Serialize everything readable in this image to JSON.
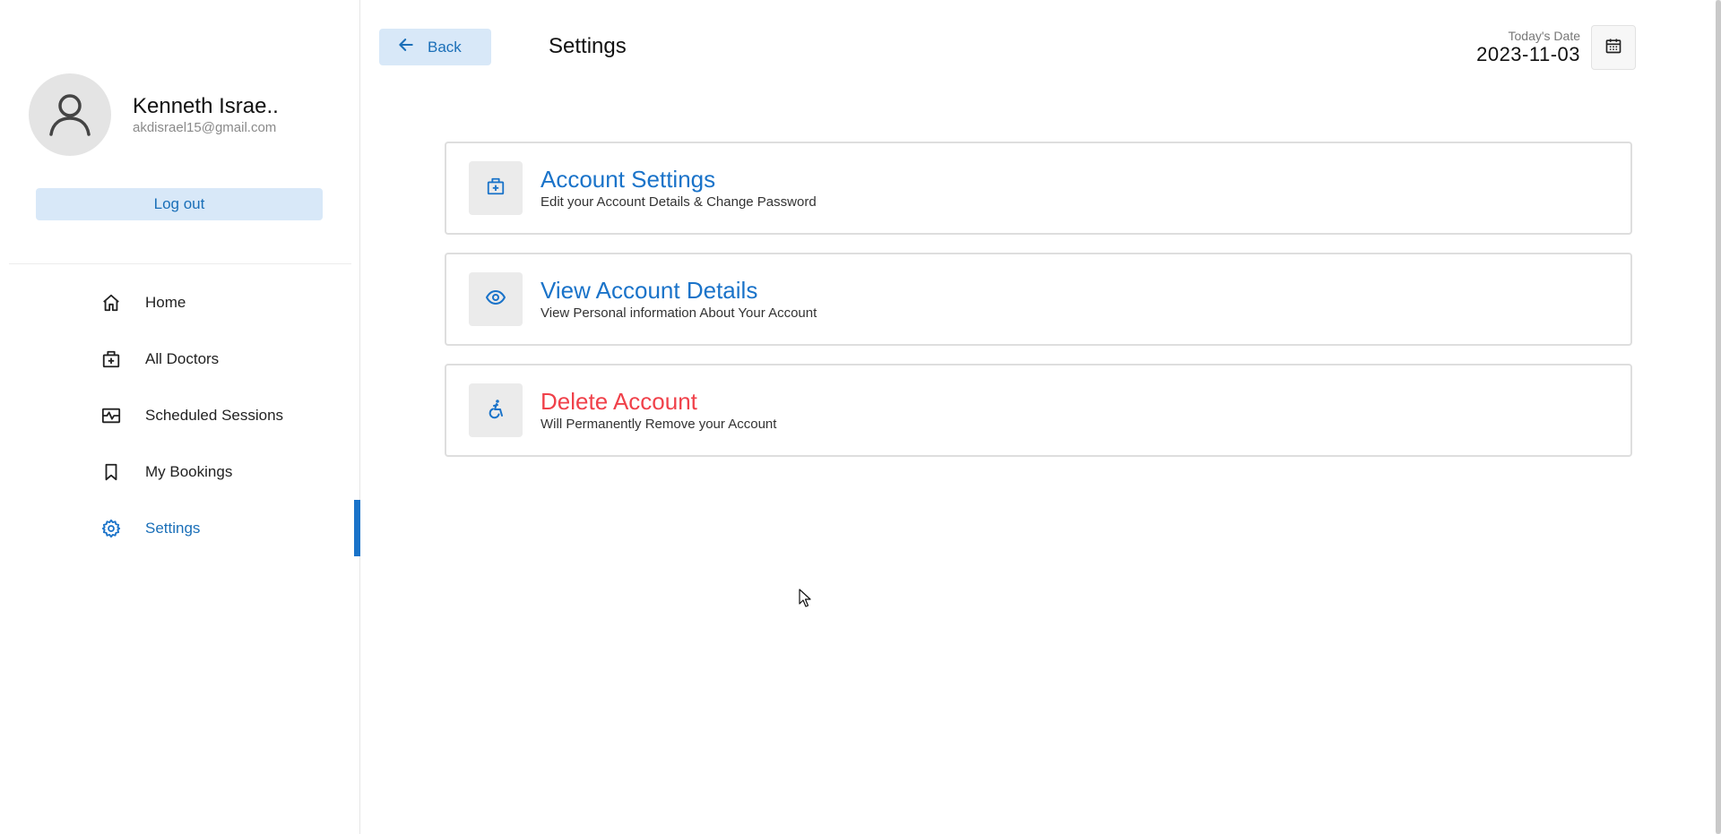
{
  "user": {
    "name": "Kenneth Israe..",
    "email": "akdisrael15@gmail.com"
  },
  "sidebar": {
    "logout_label": "Log out",
    "items": [
      {
        "label": "Home",
        "icon": "home-icon",
        "active": false
      },
      {
        "label": "All Doctors",
        "icon": "medical-bag-icon",
        "active": false
      },
      {
        "label": "Scheduled Sessions",
        "icon": "pulse-monitor-icon",
        "active": false
      },
      {
        "label": "My Bookings",
        "icon": "bookmark-icon",
        "active": false
      },
      {
        "label": "Settings",
        "icon": "gear-icon",
        "active": true
      }
    ]
  },
  "header": {
    "back_label": "Back",
    "title": "Settings",
    "date_label": "Today's Date",
    "date_value": "2023-11-03",
    "calendar_icon": "calendar-icon"
  },
  "cards": [
    {
      "title": "Account Settings",
      "description": "Edit your Account Details & Change Password",
      "icon": "medical-bag-icon",
      "danger": false
    },
    {
      "title": "View Account Details",
      "description": "View Personal information About Your Account",
      "icon": "eye-icon",
      "danger": false
    },
    {
      "title": "Delete Account",
      "description": "Will Permanently Remove your Account",
      "icon": "accessible-icon",
      "danger": true
    }
  ],
  "colors": {
    "accent": "#1a73c9",
    "accent_light": "#d8e8f8",
    "danger": "#f0414a"
  }
}
